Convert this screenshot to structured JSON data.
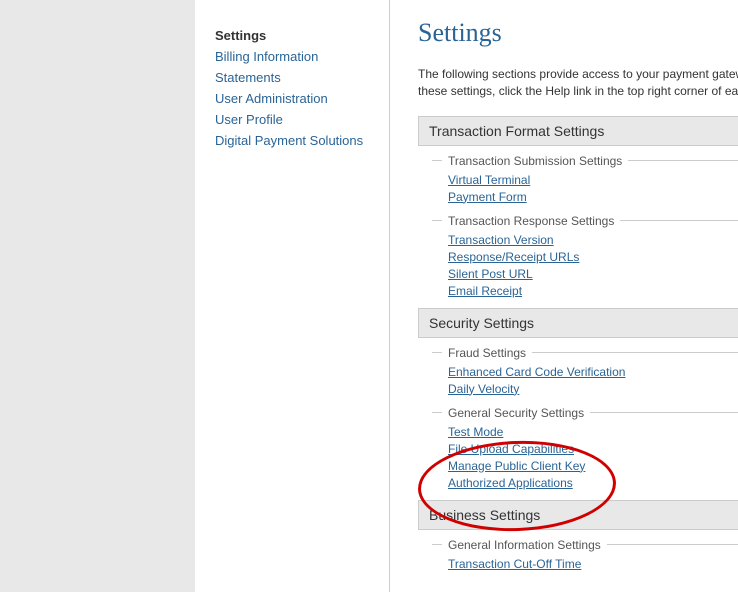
{
  "sidebar": {
    "title": "Settings",
    "items": [
      {
        "label": "Billing Information"
      },
      {
        "label": "Statements"
      },
      {
        "label": "User Administration"
      },
      {
        "label": "User Profile"
      },
      {
        "label": "Digital Payment Solutions"
      }
    ]
  },
  "main": {
    "title": "Settings",
    "intro_line1": "The following sections provide access to your payment gatew",
    "intro_line2": "these settings, click the Help link in the top right corner of eac",
    "sections": [
      {
        "header": "Transaction Format Settings",
        "subsections": [
          {
            "title": "Transaction Submission Settings",
            "links": [
              {
                "label": "Virtual Terminal"
              },
              {
                "label": "Payment Form"
              }
            ]
          },
          {
            "title": "Transaction Response Settings",
            "links": [
              {
                "label": "Transaction Version"
              },
              {
                "label": "Response/Receipt URLs"
              },
              {
                "label": "Silent Post URL"
              },
              {
                "label": "Email Receipt"
              }
            ]
          }
        ]
      },
      {
        "header": "Security Settings",
        "subsections": [
          {
            "title": "Fraud Settings",
            "links": [
              {
                "label": "Enhanced Card Code Verification"
              },
              {
                "label": "Daily Velocity"
              }
            ]
          },
          {
            "title": "General Security Settings",
            "links": [
              {
                "label": "Test Mode"
              },
              {
                "label": "File Upload Capabilities"
              },
              {
                "label": "Manage Public Client Key"
              },
              {
                "label": "Authorized Applications"
              }
            ]
          }
        ]
      },
      {
        "header": "Business Settings",
        "subsections": [
          {
            "title": "General Information Settings",
            "links": [
              {
                "label": "Transaction Cut-Off Time"
              }
            ]
          }
        ]
      }
    ]
  }
}
